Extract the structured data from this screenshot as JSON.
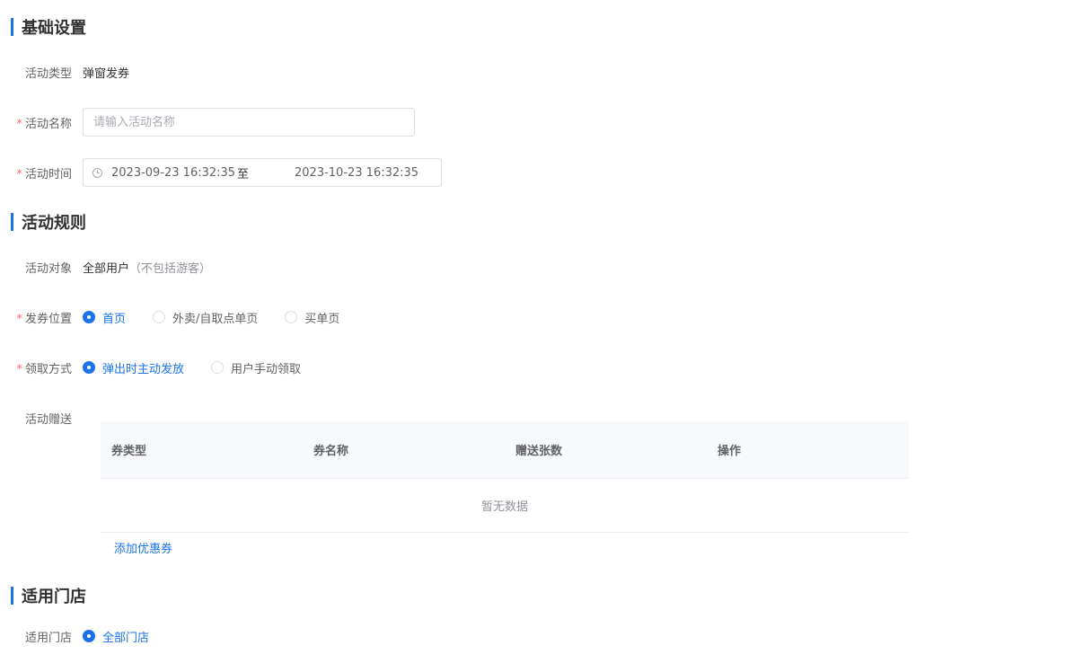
{
  "sections": {
    "basic": "基础设置",
    "rules": "活动规则",
    "stores": "适用门店"
  },
  "basic": {
    "type_label": "活动类型",
    "type_value": "弹窗发券",
    "name_label": "活动名称",
    "name_placeholder": "请输入活动名称",
    "name_value": "",
    "time_label": "活动时间",
    "time_start": "2023-09-23 16:32:35",
    "time_sep": "至",
    "time_end": "2023-10-23 16:32:35"
  },
  "rules": {
    "target_label": "活动对象",
    "target_value": "全部用户",
    "target_note": "（不包括游客）",
    "position_label": "发券位置",
    "position_options": [
      "首页",
      "外卖/自取点单页",
      "买单页"
    ],
    "method_label": "领取方式",
    "method_options": [
      "弹出时主动发放",
      "用户手动领取"
    ],
    "gift_label": "活动赠送",
    "gift_table": {
      "columns": [
        "券类型",
        "券名称",
        "赠送张数",
        "操作"
      ],
      "empty_text": "暂无数据"
    },
    "add_coupon": "添加优惠券"
  },
  "stores": {
    "label": "适用门店",
    "options": [
      "全部门店"
    ]
  },
  "required_mark": "*",
  "colors": {
    "accent": "#1a73e8",
    "required": "#f56c6c"
  }
}
